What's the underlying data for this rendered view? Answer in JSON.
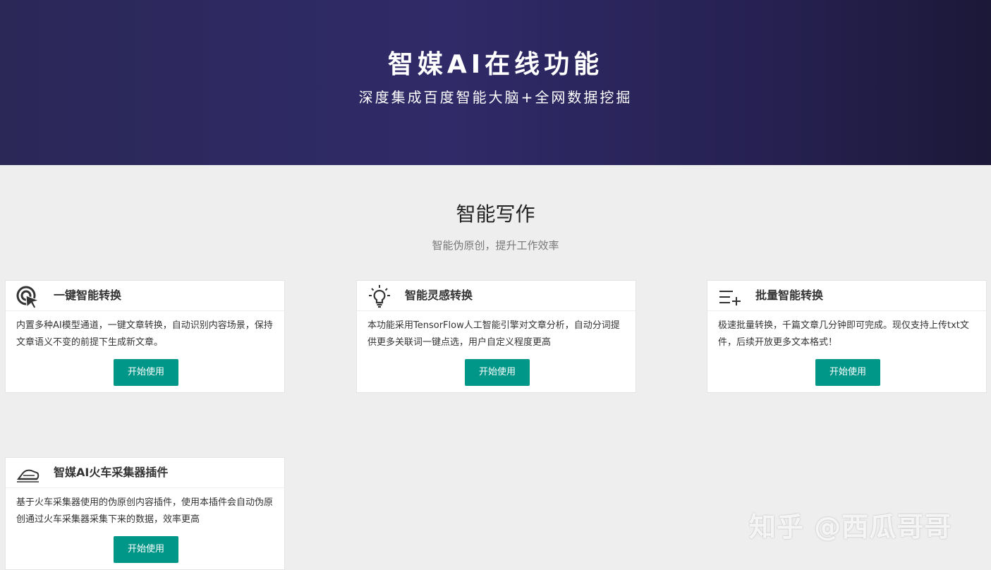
{
  "hero": {
    "title": "智媒AI在线功能",
    "subtitle": "深度集成百度智能大脑+全网数据挖掘"
  },
  "section": {
    "title": "智能写作",
    "subtitle": "智能伪原创，提升工作效率"
  },
  "cards": [
    {
      "icon": "cursor-target-icon",
      "title": "一键智能转换",
      "desc": "内置多种AI模型通道，一键文章转换，自动识别内容场景，保持文章语义不变的前提下生成新文章。",
      "button": "开始使用"
    },
    {
      "icon": "lightbulb-icon",
      "title": "智能灵感转换",
      "desc": "本功能采用TensorFlow人工智能引擎对文章分析，自动分词提供更多关联词一键点选，用户自定义程度更高",
      "button": "开始使用"
    },
    {
      "icon": "list-add-icon",
      "title": "批量智能转换",
      "desc": "极速批量转换，千篇文章几分钟即可完成。现仅支持上传txt文件，后续开放更多文本格式！",
      "button": "开始使用"
    },
    {
      "icon": "train-icon",
      "title": "智媒AI火车采集器插件",
      "desc": "基于火车采集器使用的伪原创内容插件，使用本插件会自动伪原创通过火车采集器采集下来的数据，效率更高",
      "button": "开始使用"
    }
  ],
  "watermark": "知乎 @西瓜哥哥",
  "colors": {
    "accent": "#009688",
    "hero_bg": "#2e2a63",
    "page_bg": "#eeeeee"
  }
}
